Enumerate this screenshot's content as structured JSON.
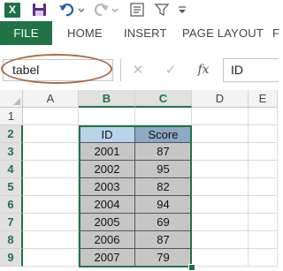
{
  "app": {
    "logo_letter": "X",
    "accent": "#217346"
  },
  "ribbon": {
    "tabs": [
      {
        "label": "FILE"
      },
      {
        "label": "HOME"
      },
      {
        "label": "INSERT"
      },
      {
        "label": "PAGE LAYOUT"
      },
      {
        "label": "F"
      }
    ]
  },
  "formula_bar": {
    "name_box": "tabel",
    "cancel_glyph": "✕",
    "enter_glyph": "✓",
    "fx_label": "fx",
    "content": "ID"
  },
  "sheet": {
    "columns": [
      "A",
      "B",
      "C",
      "D",
      "E"
    ],
    "rows": [
      "1",
      "2",
      "3",
      "4",
      "5",
      "6",
      "7",
      "8",
      "9"
    ],
    "table": {
      "headers": [
        "ID",
        "Score"
      ],
      "rows": [
        [
          "2001",
          "87"
        ],
        [
          "2002",
          "95"
        ],
        [
          "2003",
          "82"
        ],
        [
          "2004",
          "94"
        ],
        [
          "2005",
          "69"
        ],
        [
          "2006",
          "87"
        ],
        [
          "2007",
          "79"
        ]
      ]
    }
  }
}
